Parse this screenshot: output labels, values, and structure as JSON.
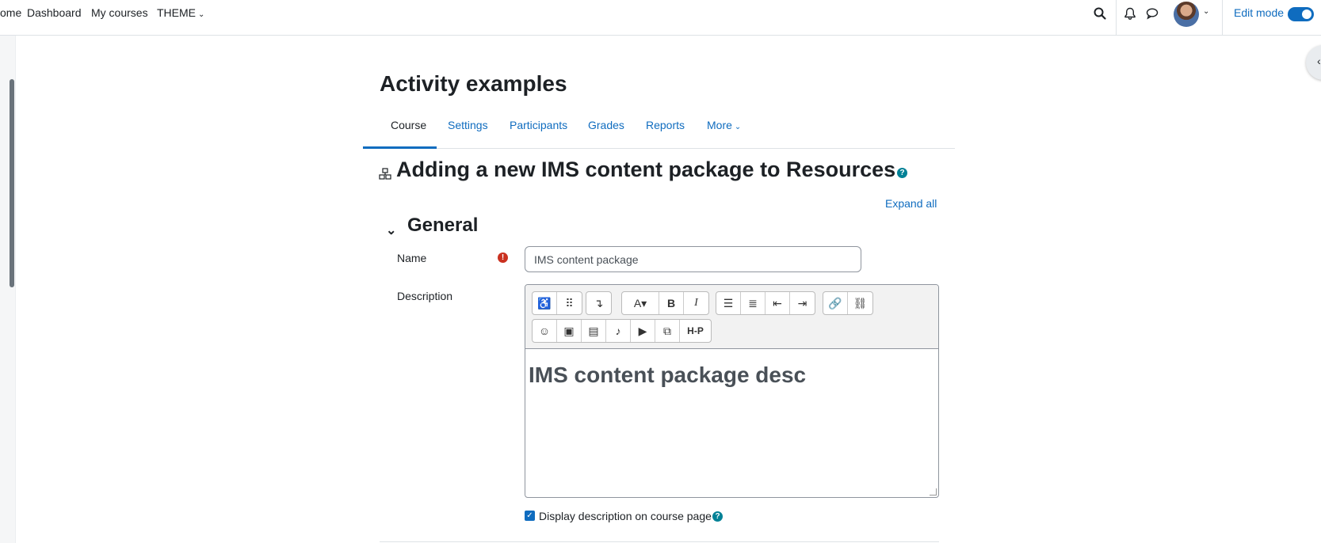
{
  "navbar": {
    "home": "ome",
    "dashboard": "Dashboard",
    "my_courses": "My courses",
    "theme": "THEME",
    "edit_mode": "Edit mode",
    "icons": [
      "search-icon",
      "bell-icon",
      "chat-icon",
      "chevron-down-icon"
    ]
  },
  "course": {
    "title": "Activity examples",
    "tabs": [
      "Course",
      "Settings",
      "Participants",
      "Grades",
      "Reports",
      "More"
    ],
    "active_tab": "Course"
  },
  "page": {
    "heading": "Adding a new IMS content package to Resources",
    "expand_all": "Expand all"
  },
  "general": {
    "title": "General",
    "name_label": "Name",
    "name_value": "IMS content package",
    "description_label": "Description",
    "description_content": "IMS content package desc",
    "display_description_label": "Display description on course page",
    "display_description_checked": true
  },
  "toolbar": {
    "row1": [
      "accessibility-checker-icon",
      "screenreader-helper-icon",
      "collapse-icon",
      "font-style-icon",
      "bold-icon",
      "italic-icon",
      "unordered-list-icon",
      "ordered-list-icon",
      "outdent-icon",
      "indent-icon",
      "link-icon",
      "unlink-icon"
    ],
    "row2": [
      "emoji-icon",
      "image-icon",
      "media-icon",
      "record-audio-icon",
      "record-video-icon",
      "manage-files-icon",
      "h5p-icon"
    ],
    "h5p": "H-P"
  },
  "colors": {
    "link": "#0f6cbf",
    "help": "#008196",
    "required": "#ca3120"
  }
}
